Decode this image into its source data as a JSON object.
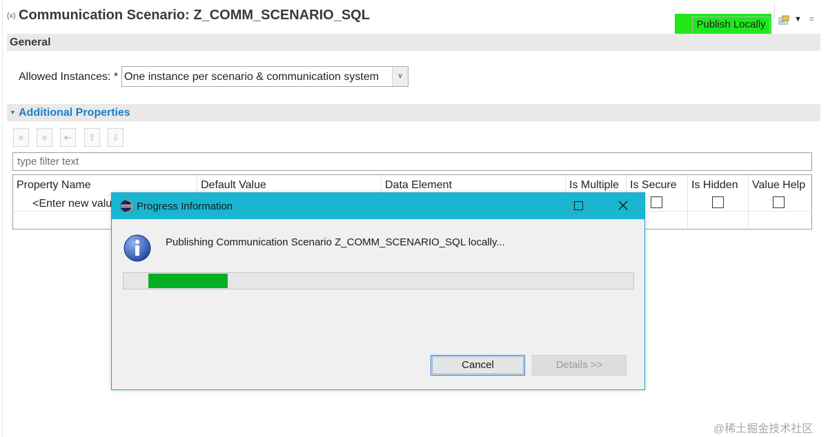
{
  "editor": {
    "title_icon": "(x)",
    "title": "Communication Scenario: Z_COMM_SCENARIO_SQL",
    "toolbar": {
      "publish_label": "Publish Locally",
      "icons": [
        "publish-config-icon",
        "dropdown-arrow-icon",
        "settings-icon"
      ]
    }
  },
  "general": {
    "section_label": "General",
    "allowed_instances_label": "Allowed Instances: *",
    "allowed_instances_value": "One instance per scenario & communication system"
  },
  "additional": {
    "section_label": "Additional Properties",
    "toolbar_icons": [
      "add-property-icon",
      "add-child-icon",
      "remove-property-icon",
      "move-up-icon",
      "move-down-icon"
    ],
    "filter_placeholder": "type filter text",
    "table": {
      "columns": [
        "Property Name",
        "Default Value",
        "Data Element",
        "Is Multiple",
        "Is Secure",
        "Is Hidden",
        "Value Help"
      ],
      "new_row_text": "<Enter new value"
    }
  },
  "dialog": {
    "title": "Progress Information",
    "message": "Publishing Communication Scenario Z_COMM_SCENARIO_SQL locally...",
    "progress_fraction": 0.155,
    "cancel_label": "Cancel",
    "details_label": "Details >>"
  },
  "watermark": "@稀土掘金技术社区",
  "colors": {
    "publish_highlight": "#22e81a",
    "section_header_text": "#1b7fc4",
    "dialog_titlebar": "#1ab5d0",
    "progress_fill": "#06b025"
  }
}
